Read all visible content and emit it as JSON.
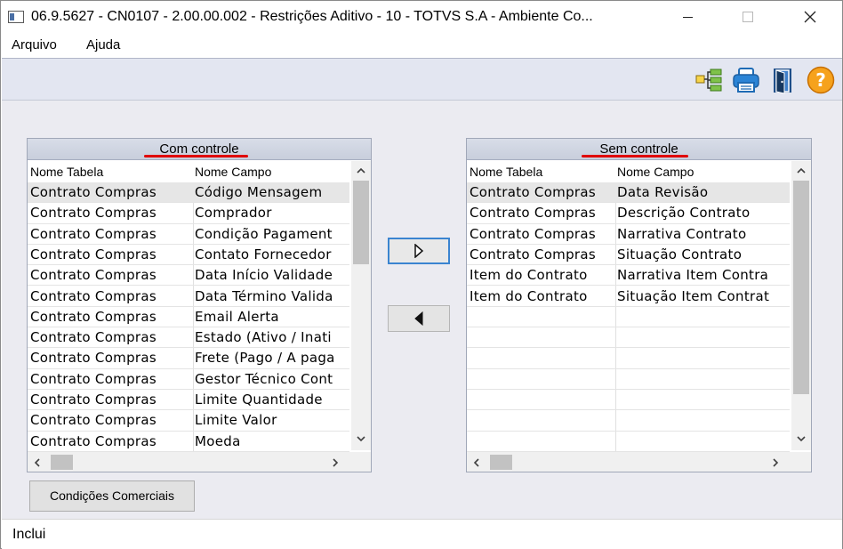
{
  "window": {
    "title": "06.9.5627 - CN0107 - 2.00.00.002 - Restrições Aditivo - 10 - TOTVS S.A - Ambiente Co...",
    "minimize_icon": "minimize-icon",
    "maximize_icon": "maximize-icon",
    "close_icon": "close-icon"
  },
  "menu": {
    "items": [
      {
        "label": "Arquivo"
      },
      {
        "label": "Ajuda"
      }
    ]
  },
  "toolbar": {
    "icons": [
      "tree-structure-icon",
      "printer-icon",
      "exit-door-icon",
      "help-icon"
    ]
  },
  "left_grid": {
    "caption": "Com controle",
    "headers": [
      "Nome Tabela",
      "Nome Campo"
    ],
    "rows": [
      {
        "tabela": "Contrato Compras",
        "campo": "Código Mensagem",
        "selected": true
      },
      {
        "tabela": "Contrato Compras",
        "campo": "Comprador"
      },
      {
        "tabela": "Contrato Compras",
        "campo": "Condição Pagament"
      },
      {
        "tabela": "Contrato Compras",
        "campo": "Contato Fornecedor"
      },
      {
        "tabela": "Contrato Compras",
        "campo": "Data Início Validade"
      },
      {
        "tabela": "Contrato Compras",
        "campo": "Data Término Valida"
      },
      {
        "tabela": "Contrato Compras",
        "campo": "Email Alerta"
      },
      {
        "tabela": "Contrato Compras",
        "campo": "Estado (Ativo / Inati"
      },
      {
        "tabela": "Contrato Compras",
        "campo": "Frete (Pago / A paga"
      },
      {
        "tabela": "Contrato Compras",
        "campo": "Gestor Técnico Cont"
      },
      {
        "tabela": "Contrato Compras",
        "campo": "Limite Quantidade"
      },
      {
        "tabela": "Contrato Compras",
        "campo": "Limite Valor"
      },
      {
        "tabela": "Contrato Compras",
        "campo": "Moeda"
      }
    ]
  },
  "right_grid": {
    "caption": "Sem controle",
    "headers": [
      "Nome Tabela",
      "Nome Campo"
    ],
    "rows": [
      {
        "tabela": "Contrato Compras",
        "campo": "Data Revisão",
        "selected": true
      },
      {
        "tabela": "Contrato Compras",
        "campo": "Descrição Contrato"
      },
      {
        "tabela": "Contrato Compras",
        "campo": "Narrativa Contrato"
      },
      {
        "tabela": "Contrato Compras",
        "campo": "Situação Contrato"
      },
      {
        "tabela": "Item do Contrato",
        "campo": "Narrativa Item Contra"
      },
      {
        "tabela": "Item do Contrato",
        "campo": "Situação Item Contrat"
      },
      {
        "tabela": "",
        "campo": ""
      },
      {
        "tabela": "",
        "campo": ""
      },
      {
        "tabela": "",
        "campo": ""
      },
      {
        "tabela": "",
        "campo": ""
      },
      {
        "tabela": "",
        "campo": ""
      },
      {
        "tabela": "",
        "campo": ""
      },
      {
        "tabela": "",
        "campo": ""
      }
    ]
  },
  "buttons": {
    "condicoes_comerciais": "Condições Comerciais",
    "move_right_icon": "arrow-right-icon",
    "move_left_icon": "arrow-left-icon"
  },
  "status": {
    "text": "Inclui"
  },
  "colors": {
    "toolbar_bg": "#e3e6f1",
    "content_bg": "#ebebf1",
    "caption_underline": "#e00000",
    "focus_border": "#3a84d0"
  }
}
